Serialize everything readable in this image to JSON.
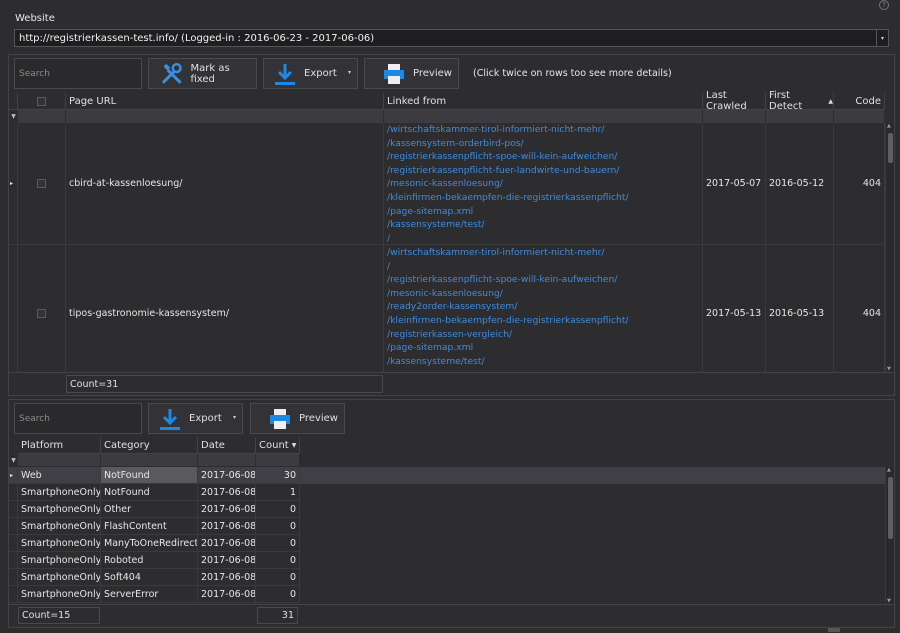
{
  "website": {
    "label": "Website",
    "value": "http://registrierkassen-test.info/ (Logged-in : 2016-06-23 - 2017-06-06)"
  },
  "top": {
    "search_placeholder": "Search",
    "mark_fixed_label": "Mark as fixed",
    "export_label": "Export",
    "preview_label": "Preview",
    "hint": "(Click twice on rows too see more details)",
    "columns": [
      "Page URL",
      "Linked from",
      "Last Crawled",
      "First Detect",
      "Code"
    ],
    "rows": [
      {
        "page_url": "cbird-at-kassenloesung/",
        "linked_from": [
          "/wirtschaftskammer-tirol-informiert-nicht-mehr/",
          "/kassensystem-orderbird-pos/",
          "/registrierkassenpflicht-spoe-will-kein-aufweichen/",
          "/registrierkassenpflicht-fuer-landwirte-und-bauern/",
          "/mesonic-kassenloesung/",
          "/kleinfirmen-bekaempfen-die-registrierkassenpflicht/",
          "/page-sitemap.xml",
          "/kassensysteme/test/",
          "/"
        ],
        "last_crawled": "2017-05-07",
        "first_detect": "2016-05-12",
        "code": "404"
      },
      {
        "page_url": "tipos-gastronomie-kassensystem/",
        "linked_from": [
          "/wirtschaftskammer-tirol-informiert-nicht-mehr/",
          "/",
          "/registrierkassenpflicht-spoe-will-kein-aufweichen/",
          "/mesonic-kassenloesung/",
          "/ready2order-kassensystem/",
          "/kleinfirmen-bekaempfen-die-registrierkassenpflicht/",
          "/registrierkassen-vergleich/",
          "/page-sitemap.xml",
          "/kassensysteme/test/"
        ],
        "last_crawled": "2017-05-13",
        "first_detect": "2016-05-13",
        "code": "404"
      }
    ],
    "count": "Count=31"
  },
  "bottom": {
    "search_placeholder": "Search",
    "export_label": "Export",
    "preview_label": "Preview",
    "columns": [
      "Platform",
      "Category",
      "Date",
      "Count"
    ],
    "rows": [
      {
        "platform": "Web",
        "category": "NotFound",
        "date": "2017-06-08",
        "count": "30"
      },
      {
        "platform": "SmartphoneOnly",
        "category": "NotFound",
        "date": "2017-06-08",
        "count": "1"
      },
      {
        "platform": "SmartphoneOnly",
        "category": "Other",
        "date": "2017-06-08",
        "count": "0"
      },
      {
        "platform": "SmartphoneOnly",
        "category": "FlashContent",
        "date": "2017-06-08",
        "count": "0"
      },
      {
        "platform": "SmartphoneOnly",
        "category": "ManyToOneRedirect",
        "date": "2017-06-08",
        "count": "0"
      },
      {
        "platform": "SmartphoneOnly",
        "category": "Roboted",
        "date": "2017-06-08",
        "count": "0"
      },
      {
        "platform": "SmartphoneOnly",
        "category": "Soft404",
        "date": "2017-06-08",
        "count": "0"
      },
      {
        "platform": "SmartphoneOnly",
        "category": "ServerError",
        "date": "2017-06-08",
        "count": "0"
      }
    ],
    "count_label": "Count=15",
    "count_total": "31"
  },
  "colors": {
    "background": "#2d2d30",
    "link": "#3f8bdc",
    "accent_icon": "#1e88e5"
  }
}
